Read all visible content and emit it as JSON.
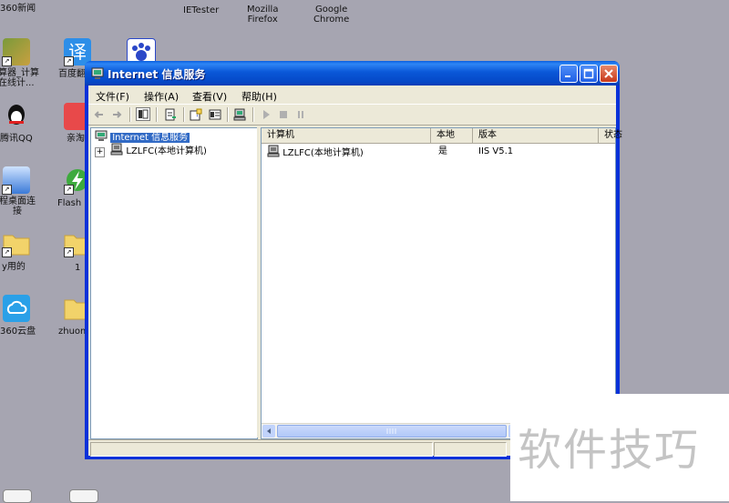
{
  "desktop": {
    "top_labels": [
      "360新闻",
      "IETester",
      "Mozilla\nFirefox",
      "Google\nChrome"
    ],
    "icons": [
      {
        "label": "算器_计算\n在线计...",
        "icon": "calculator-icon"
      },
      {
        "label": "百度翻",
        "icon": "translate-icon"
      },
      {
        "label": "",
        "icon": "paw-icon"
      },
      {
        "label": "腾讯QQ",
        "icon": "qq-icon"
      },
      {
        "label": "亲淘",
        "icon": "qintao-icon"
      },
      {
        "label": "程桌面连\n接",
        "icon": "remote-desktop-icon"
      },
      {
        "label": "Flash",
        "icon": "flash-icon"
      },
      {
        "label": "y用的",
        "icon": "folder-icon"
      },
      {
        "label": "1",
        "icon": "folder-icon"
      },
      {
        "label": "360云盘",
        "icon": "cloud-icon"
      },
      {
        "label": "zhuom",
        "icon": "folder-icon"
      }
    ]
  },
  "window": {
    "title": "Internet 信息服务",
    "menu": [
      "文件(F)",
      "操作(A)",
      "查看(V)",
      "帮助(H)"
    ],
    "tree": {
      "root": "Internet 信息服务",
      "child": "LZLFC(本地计算机)",
      "expander": "+"
    },
    "list": {
      "columns": [
        "计算机",
        "本地",
        "版本",
        "状态"
      ],
      "rows": [
        {
          "computer": "LZLFC(本地计算机)",
          "local": "是",
          "version": "IIS V5.1",
          "status": ""
        }
      ]
    }
  },
  "watermark": "软件技巧",
  "colors": {
    "desktop": "#a6a5b1",
    "titlebar": "#0a58d8",
    "selection": "#316ac5",
    "window_face": "#ece9d8"
  }
}
